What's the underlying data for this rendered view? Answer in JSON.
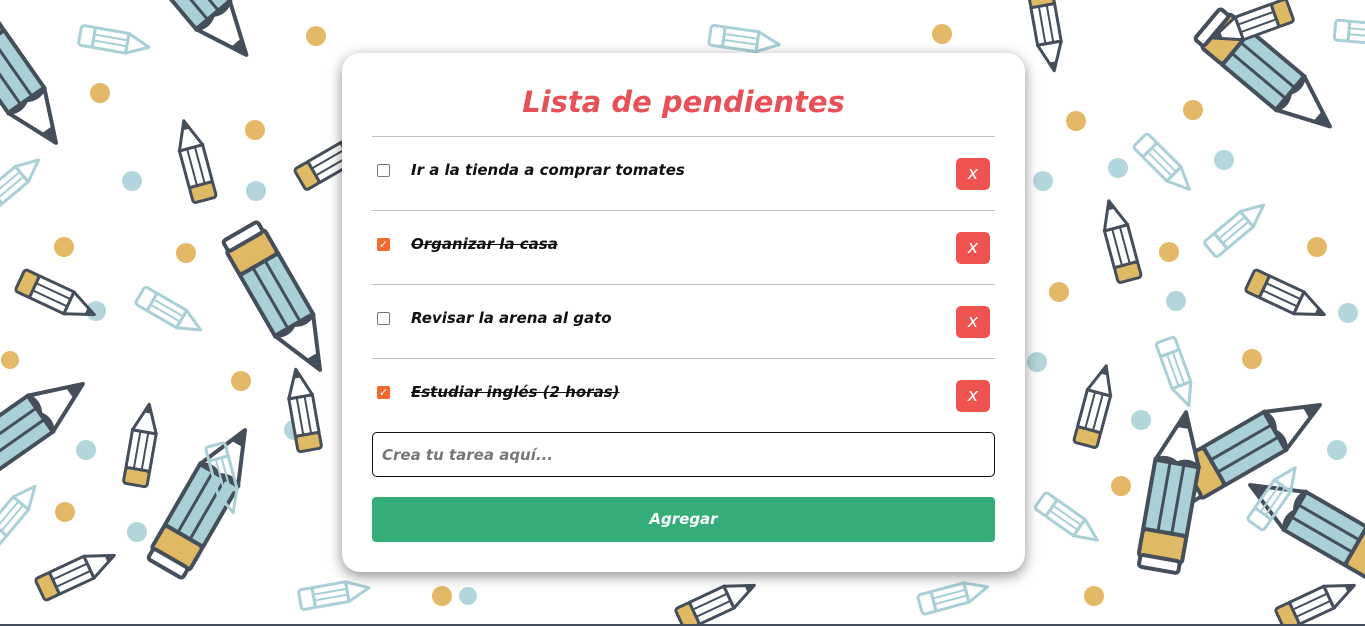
{
  "app": {
    "title": "Lista de pendientes",
    "tasks": [
      {
        "text": "Ir a la tienda a comprar tomates",
        "done": false,
        "delete_label": "x"
      },
      {
        "text": "Organizar la casa",
        "done": true,
        "delete_label": "x"
      },
      {
        "text": "Revisar la arena al gato",
        "done": false,
        "delete_label": "x"
      },
      {
        "text": "Estudiar inglés (2 horas)",
        "done": true,
        "delete_label": "x"
      }
    ],
    "input": {
      "placeholder": "Crea tu tarea aquí...",
      "value": ""
    },
    "add_label": "Agregar"
  },
  "theme": {
    "title_color": "#e85057",
    "check_color": "#f26a2e",
    "delete_color": "#ef5350",
    "add_color": "#34ad78",
    "pattern": {
      "outline": "#454f5b",
      "blue": "#a8d0d6",
      "yellow": "#e0b964",
      "dot_yellow": "#e3b866",
      "dot_blue": "#b2d6dc"
    }
  },
  "icons": {
    "checkbox_checked": "check-icon",
    "delete": "close-icon",
    "background": "pencil-pattern"
  }
}
